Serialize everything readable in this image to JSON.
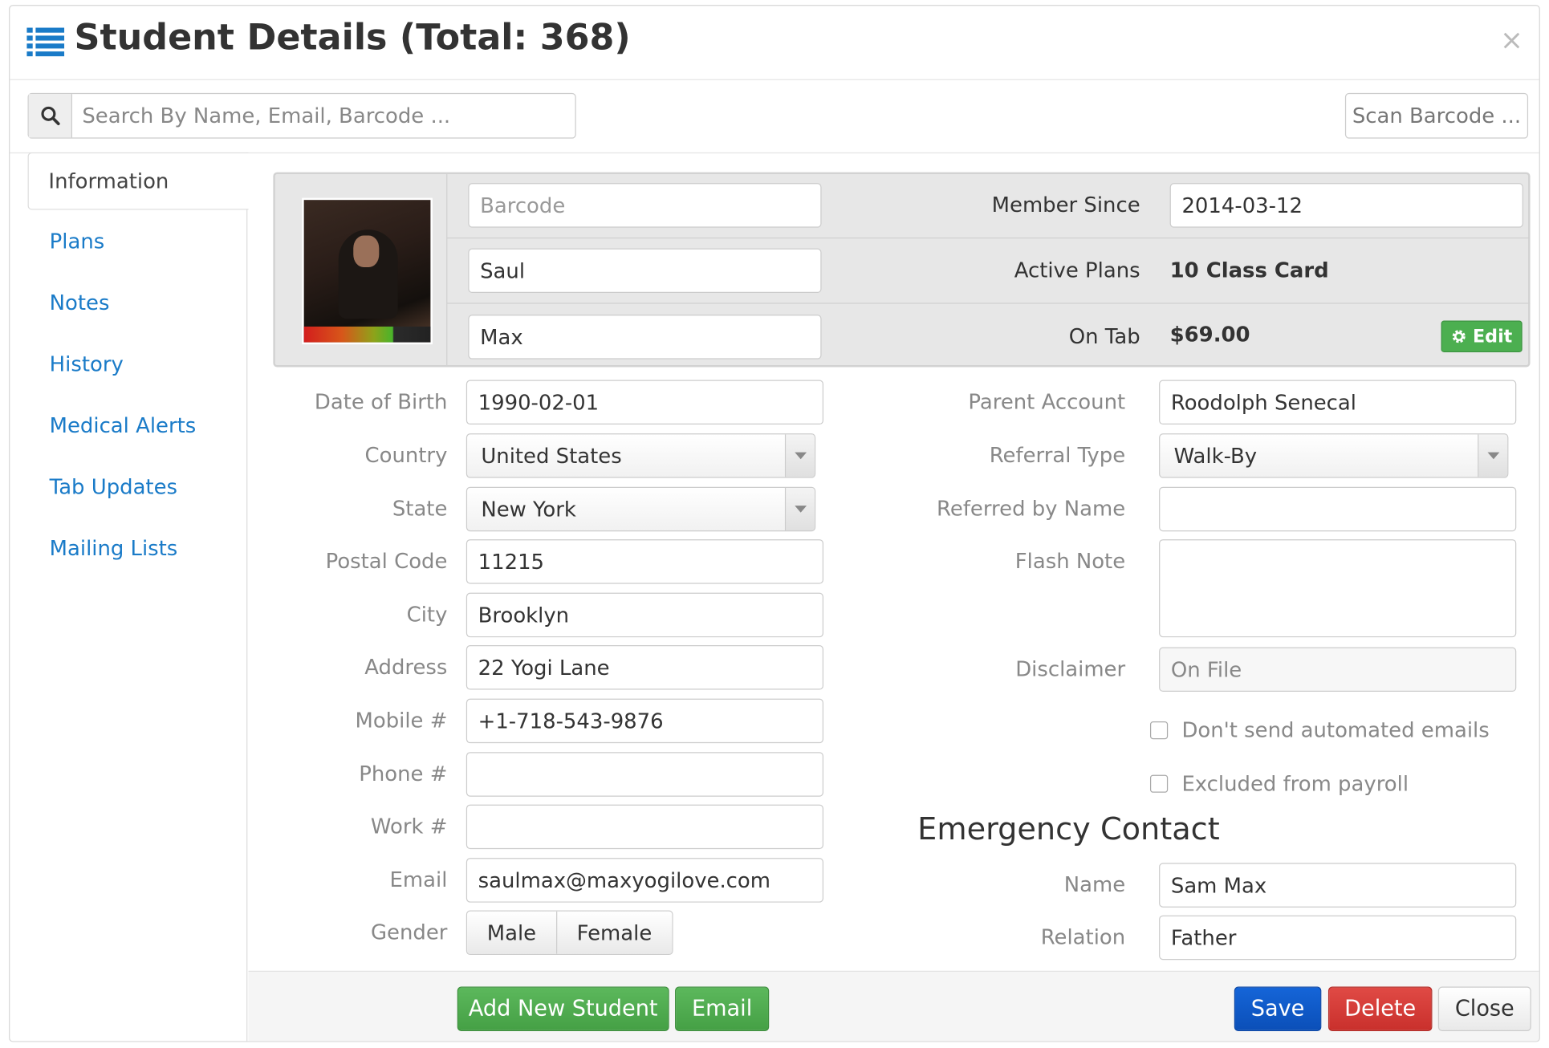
{
  "header": {
    "title": "Student Details (Total: 368)",
    "icon": "list-icon",
    "close_label": "×"
  },
  "search": {
    "placeholder": "Search By Name, Email, Barcode ...",
    "icon": "search-icon",
    "scan_label": "Scan Barcode ..."
  },
  "sidebar": {
    "active_tab": "Information",
    "items": [
      {
        "label": "Plans"
      },
      {
        "label": "Notes"
      },
      {
        "label": "History"
      },
      {
        "label": "Medical Alerts"
      },
      {
        "label": "Tab Updates"
      },
      {
        "label": "Mailing Lists"
      }
    ]
  },
  "profile": {
    "barcode_placeholder": "Barcode",
    "first_name": "Saul",
    "last_name": "Max",
    "member_since_label": "Member Since",
    "member_since": "2014-03-12",
    "active_plans_label": "Active Plans",
    "active_plans": "10 Class Card",
    "on_tab_label": "On Tab",
    "on_tab": "$69.00",
    "edit_label": "Edit"
  },
  "form_left": {
    "dob_label": "Date of Birth",
    "dob": "1990-02-01",
    "country_label": "Country",
    "country": "United States",
    "state_label": "State",
    "state": "New York",
    "postal_label": "Postal Code",
    "postal": "11215",
    "city_label": "City",
    "city": "Brooklyn",
    "address_label": "Address",
    "address": "22 Yogi Lane",
    "mobile_label": "Mobile #",
    "mobile": "+1-718-543-9876",
    "phone_label": "Phone #",
    "phone": "",
    "work_label": "Work #",
    "work": "",
    "email_label": "Email",
    "email": "saulmax@maxyogilove.com",
    "gender_label": "Gender",
    "gender_options": [
      "Male",
      "Female"
    ]
  },
  "form_right": {
    "parent_label": "Parent Account",
    "parent": "Roodolph Senecal",
    "referral_type_label": "Referral Type",
    "referral_type": "Walk-By",
    "referred_by_label": "Referred by Name",
    "referred_by": "",
    "flash_note_label": "Flash Note",
    "flash_note": "",
    "disclaimer_label": "Disclaimer",
    "disclaimer": "On File",
    "no_emails_label": "Don't send automated emails",
    "no_emails_checked": false,
    "excluded_payroll_label": "Excluded from payroll",
    "excluded_payroll_checked": false
  },
  "emergency": {
    "title": "Emergency Contact",
    "name_label": "Name",
    "name": "Sam Max",
    "relation_label": "Relation",
    "relation": "Father"
  },
  "footer": {
    "add_student": "Add New Student",
    "email": "Email",
    "save": "Save",
    "delete": "Delete",
    "close": "Close"
  },
  "colors": {
    "link": "#1a7bc8",
    "green": "#5cb85c",
    "blue": "#1565d8",
    "red": "#d9534f"
  }
}
